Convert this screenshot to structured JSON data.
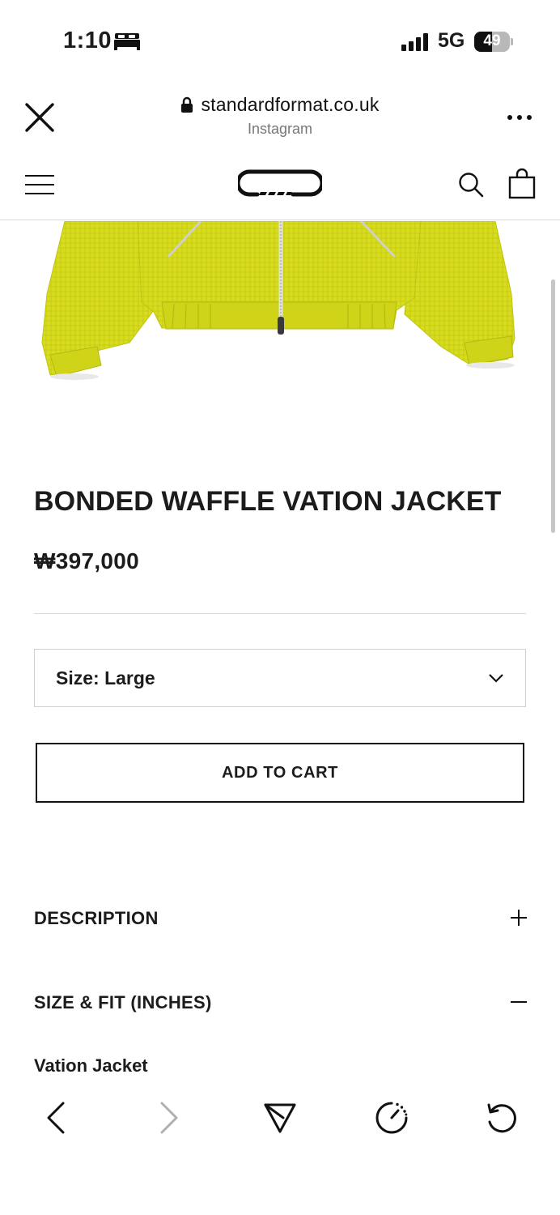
{
  "status_bar": {
    "time": "1:10",
    "network": "5G",
    "battery_percent": "49",
    "battery_level": 0.49,
    "focus_icon": "bed-icon"
  },
  "browser": {
    "url": "standardformat.co.uk",
    "source": "Instagram",
    "close_icon": "close-icon",
    "more_icon": "more-icon"
  },
  "site_header": {
    "menu_icon": "hamburger-menu-icon",
    "logo_icon": "brand-logo",
    "search_icon": "search-icon",
    "cart_icon": "shopping-bag-icon"
  },
  "product": {
    "image_icon": "yellow-jacket-image",
    "image_color": "#d7dc1c",
    "title": "BONDED WAFFLE VATION JACKET",
    "price": "₩397,000",
    "size_select": {
      "selected": "Size: Large"
    },
    "add_to_cart": "ADD TO CART",
    "accordions": [
      {
        "label": "DESCRIPTION",
        "state": "collapsed",
        "icon": "plus-icon"
      },
      {
        "label": "SIZE & FIT (INCHES)",
        "state": "expanded",
        "icon": "minus-icon"
      }
    ],
    "size_fit_heading": "Vation Jacket"
  },
  "toolbar": {
    "back_icon": "back-icon",
    "forward_icon": "forward-icon",
    "share_icon": "share-icon",
    "speed_icon": "speed-icon",
    "reload_icon": "reload-icon"
  },
  "colors": {
    "text": "#1c1c1c",
    "divider": "#d8d8d8",
    "disabled": "#b0b0b0"
  }
}
